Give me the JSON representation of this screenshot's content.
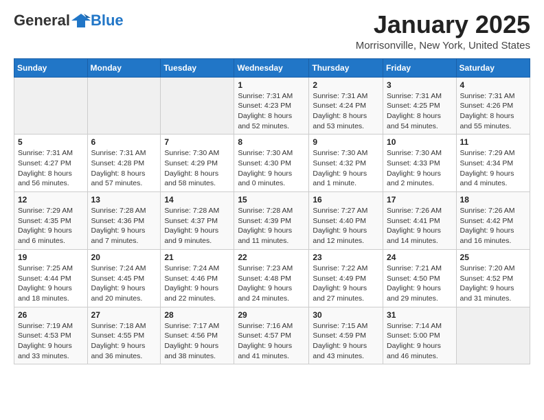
{
  "header": {
    "logo_general": "General",
    "logo_blue": "Blue",
    "title": "January 2025",
    "subtitle": "Morrisonville, New York, United States"
  },
  "weekdays": [
    "Sunday",
    "Monday",
    "Tuesday",
    "Wednesday",
    "Thursday",
    "Friday",
    "Saturday"
  ],
  "weeks": [
    [
      {
        "day": "",
        "info": ""
      },
      {
        "day": "",
        "info": ""
      },
      {
        "day": "",
        "info": ""
      },
      {
        "day": "1",
        "info": "Sunrise: 7:31 AM\nSunset: 4:23 PM\nDaylight: 8 hours\nand 52 minutes."
      },
      {
        "day": "2",
        "info": "Sunrise: 7:31 AM\nSunset: 4:24 PM\nDaylight: 8 hours\nand 53 minutes."
      },
      {
        "day": "3",
        "info": "Sunrise: 7:31 AM\nSunset: 4:25 PM\nDaylight: 8 hours\nand 54 minutes."
      },
      {
        "day": "4",
        "info": "Sunrise: 7:31 AM\nSunset: 4:26 PM\nDaylight: 8 hours\nand 55 minutes."
      }
    ],
    [
      {
        "day": "5",
        "info": "Sunrise: 7:31 AM\nSunset: 4:27 PM\nDaylight: 8 hours\nand 56 minutes."
      },
      {
        "day": "6",
        "info": "Sunrise: 7:31 AM\nSunset: 4:28 PM\nDaylight: 8 hours\nand 57 minutes."
      },
      {
        "day": "7",
        "info": "Sunrise: 7:30 AM\nSunset: 4:29 PM\nDaylight: 8 hours\nand 58 minutes."
      },
      {
        "day": "8",
        "info": "Sunrise: 7:30 AM\nSunset: 4:30 PM\nDaylight: 9 hours\nand 0 minutes."
      },
      {
        "day": "9",
        "info": "Sunrise: 7:30 AM\nSunset: 4:32 PM\nDaylight: 9 hours\nand 1 minute."
      },
      {
        "day": "10",
        "info": "Sunrise: 7:30 AM\nSunset: 4:33 PM\nDaylight: 9 hours\nand 2 minutes."
      },
      {
        "day": "11",
        "info": "Sunrise: 7:29 AM\nSunset: 4:34 PM\nDaylight: 9 hours\nand 4 minutes."
      }
    ],
    [
      {
        "day": "12",
        "info": "Sunrise: 7:29 AM\nSunset: 4:35 PM\nDaylight: 9 hours\nand 6 minutes."
      },
      {
        "day": "13",
        "info": "Sunrise: 7:28 AM\nSunset: 4:36 PM\nDaylight: 9 hours\nand 7 minutes."
      },
      {
        "day": "14",
        "info": "Sunrise: 7:28 AM\nSunset: 4:37 PM\nDaylight: 9 hours\nand 9 minutes."
      },
      {
        "day": "15",
        "info": "Sunrise: 7:28 AM\nSunset: 4:39 PM\nDaylight: 9 hours\nand 11 minutes."
      },
      {
        "day": "16",
        "info": "Sunrise: 7:27 AM\nSunset: 4:40 PM\nDaylight: 9 hours\nand 12 minutes."
      },
      {
        "day": "17",
        "info": "Sunrise: 7:26 AM\nSunset: 4:41 PM\nDaylight: 9 hours\nand 14 minutes."
      },
      {
        "day": "18",
        "info": "Sunrise: 7:26 AM\nSunset: 4:42 PM\nDaylight: 9 hours\nand 16 minutes."
      }
    ],
    [
      {
        "day": "19",
        "info": "Sunrise: 7:25 AM\nSunset: 4:44 PM\nDaylight: 9 hours\nand 18 minutes."
      },
      {
        "day": "20",
        "info": "Sunrise: 7:24 AM\nSunset: 4:45 PM\nDaylight: 9 hours\nand 20 minutes."
      },
      {
        "day": "21",
        "info": "Sunrise: 7:24 AM\nSunset: 4:46 PM\nDaylight: 9 hours\nand 22 minutes."
      },
      {
        "day": "22",
        "info": "Sunrise: 7:23 AM\nSunset: 4:48 PM\nDaylight: 9 hours\nand 24 minutes."
      },
      {
        "day": "23",
        "info": "Sunrise: 7:22 AM\nSunset: 4:49 PM\nDaylight: 9 hours\nand 27 minutes."
      },
      {
        "day": "24",
        "info": "Sunrise: 7:21 AM\nSunset: 4:50 PM\nDaylight: 9 hours\nand 29 minutes."
      },
      {
        "day": "25",
        "info": "Sunrise: 7:20 AM\nSunset: 4:52 PM\nDaylight: 9 hours\nand 31 minutes."
      }
    ],
    [
      {
        "day": "26",
        "info": "Sunrise: 7:19 AM\nSunset: 4:53 PM\nDaylight: 9 hours\nand 33 minutes."
      },
      {
        "day": "27",
        "info": "Sunrise: 7:18 AM\nSunset: 4:55 PM\nDaylight: 9 hours\nand 36 minutes."
      },
      {
        "day": "28",
        "info": "Sunrise: 7:17 AM\nSunset: 4:56 PM\nDaylight: 9 hours\nand 38 minutes."
      },
      {
        "day": "29",
        "info": "Sunrise: 7:16 AM\nSunset: 4:57 PM\nDaylight: 9 hours\nand 41 minutes."
      },
      {
        "day": "30",
        "info": "Sunrise: 7:15 AM\nSunset: 4:59 PM\nDaylight: 9 hours\nand 43 minutes."
      },
      {
        "day": "31",
        "info": "Sunrise: 7:14 AM\nSunset: 5:00 PM\nDaylight: 9 hours\nand 46 minutes."
      },
      {
        "day": "",
        "info": ""
      }
    ]
  ]
}
